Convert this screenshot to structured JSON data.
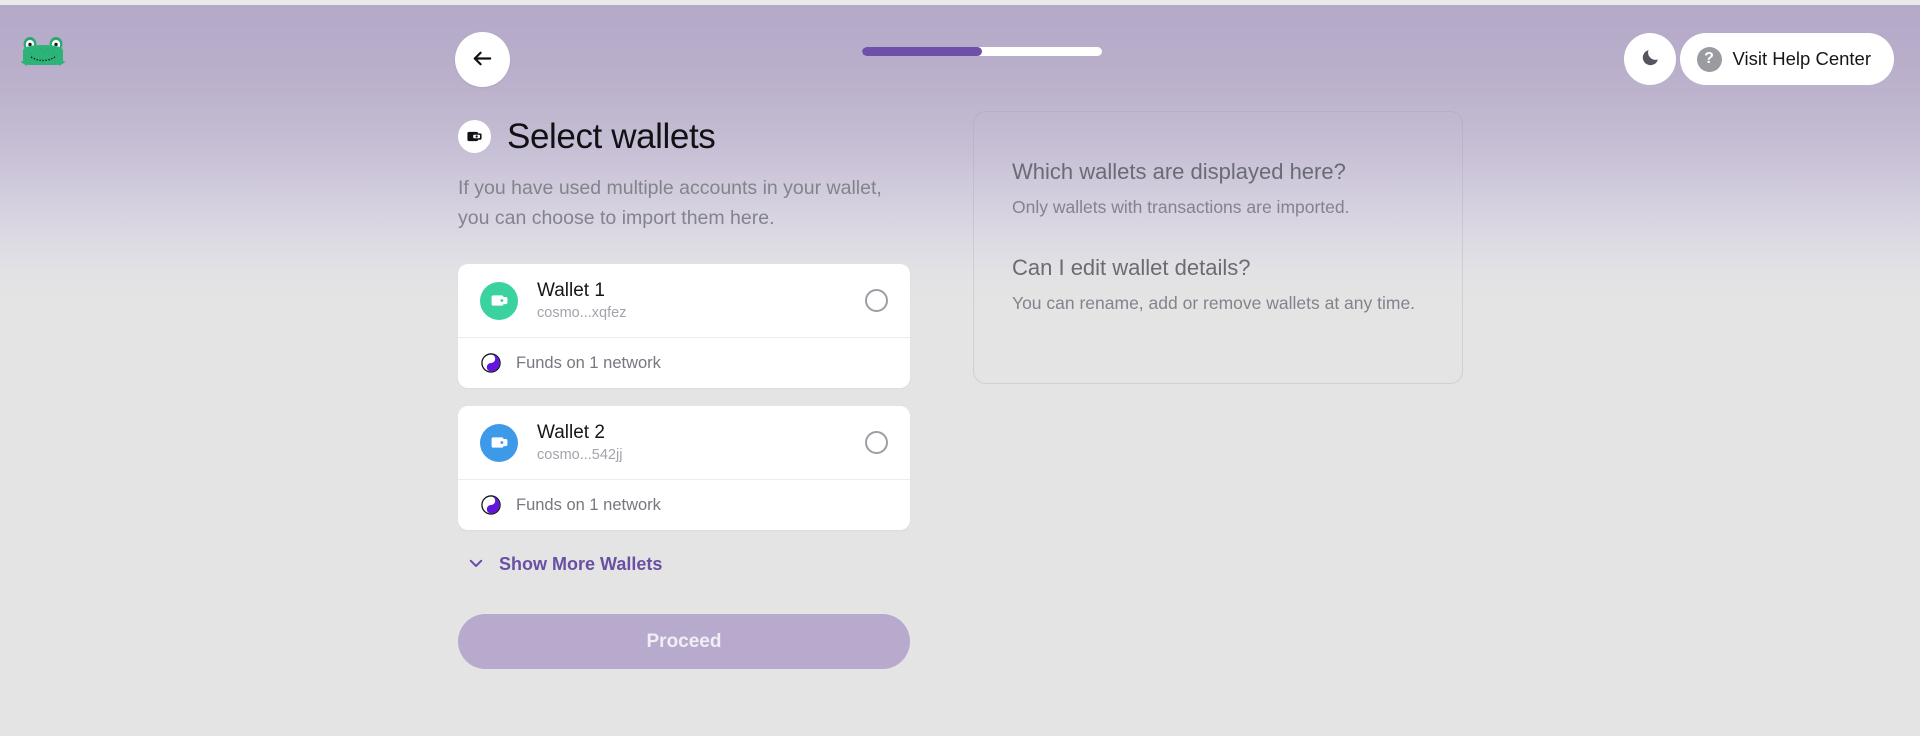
{
  "header": {
    "logo_icon": "frog-logo",
    "back_icon": "arrow-left-icon",
    "progress": {
      "percent": 50,
      "fill_color": "#6f4fa8",
      "track_color": "#ffffff"
    },
    "theme_toggle_icon": "moon-icon",
    "help": {
      "icon": "question-mark-icon",
      "label": "Visit Help Center"
    }
  },
  "main": {
    "title_icon": "wallet-icon",
    "title": "Select wallets",
    "subtitle": "If you have used multiple accounts in your wallet, you can choose to import them here.",
    "wallets": [
      {
        "name": "Wallet 1",
        "address": "cosmo...xqfez",
        "avatar_color": "#3ad29f",
        "avatar_icon": "wallet-icon",
        "selected": false,
        "network_icon": "network-swirl-icon",
        "network_label": "Funds on 1 network"
      },
      {
        "name": "Wallet 2",
        "address": "cosmo...542jj",
        "avatar_color": "#3d9ae8",
        "avatar_icon": "wallet-icon",
        "selected": false,
        "network_icon": "network-swirl-icon",
        "network_label": "Funds on 1 network"
      }
    ],
    "show_more": {
      "icon": "chevron-down-icon",
      "label": "Show More Wallets"
    },
    "proceed_label": "Proceed"
  },
  "faq": [
    {
      "question": "Which wallets are displayed here?",
      "answer": "Only wallets with transactions are imported."
    },
    {
      "question": "Can I edit wallet details?",
      "answer": "You can rename, add or remove wallets at any time."
    }
  ],
  "colors": {
    "accent_purple": "#6a4fa3",
    "background_top": "#b5a9c8",
    "background_bottom": "#e4e4e4",
    "card_white": "#ffffff"
  }
}
